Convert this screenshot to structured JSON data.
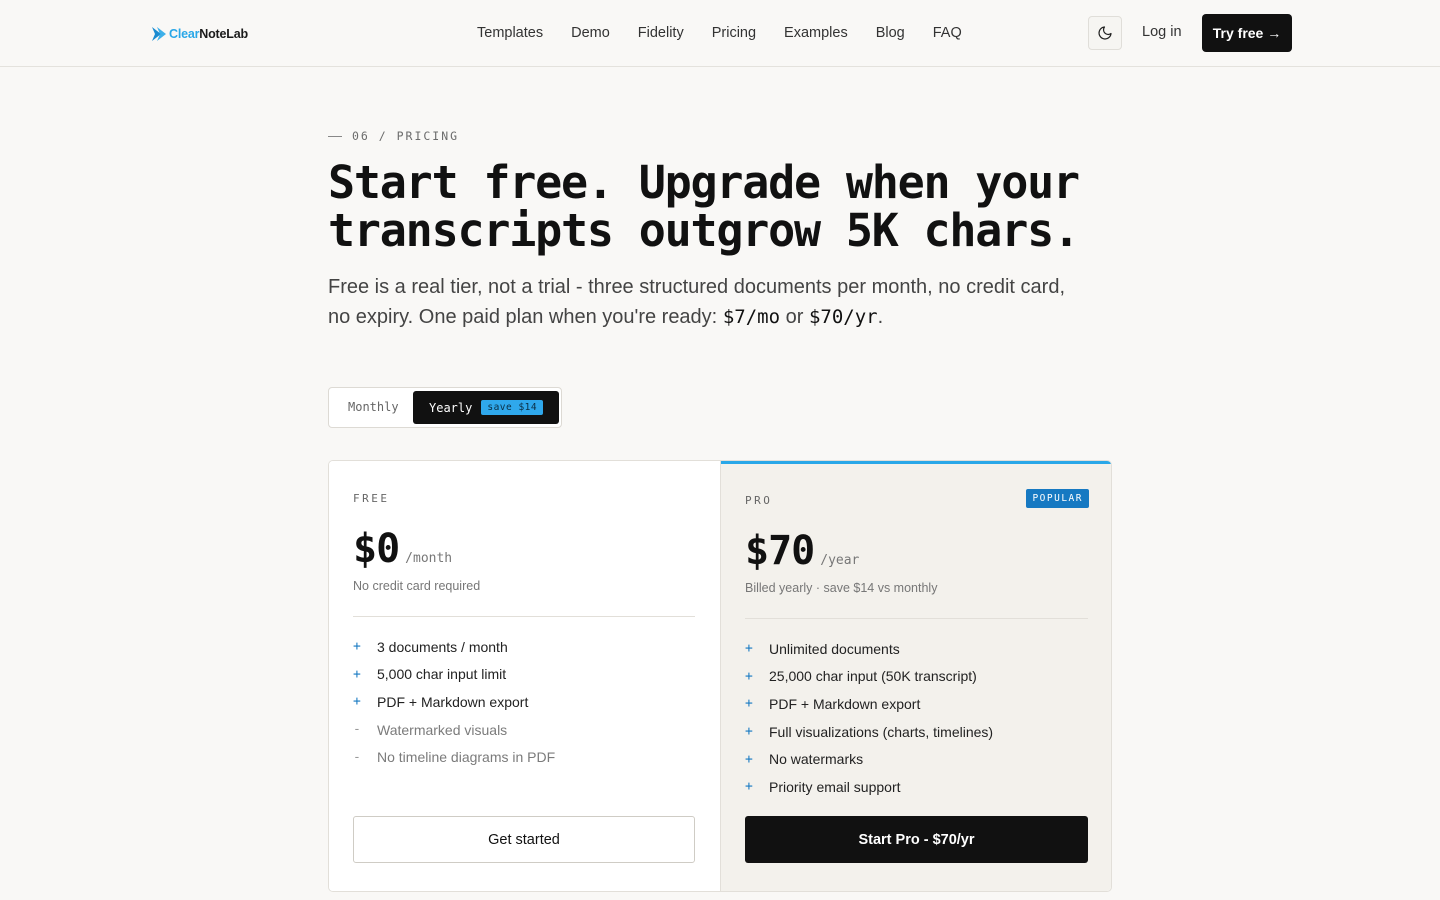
{
  "header": {
    "logo": {
      "brand_accent": "Clear",
      "brand_rest": "NoteLab",
      "icon": "logo-chevron-icon",
      "accent_color": "#29a7e8"
    },
    "nav": [
      "Templates",
      "Demo",
      "Fidelity",
      "Pricing",
      "Examples",
      "Blog",
      "FAQ"
    ],
    "theme_toggle_icon": "moon-icon",
    "login": "Log in",
    "cta": "Try free →"
  },
  "hero": {
    "eyebrow": "06 / PRICING",
    "headline_line1": "Start free. Upgrade when your",
    "headline_line2": "transcripts outgrow 5K chars.",
    "sub_text": "Free is a real tier, not a trial - three structured documents per month, no credit card, no expiry. One paid plan when you're ready:",
    "sub_price_monthly": "$7/mo",
    "sub_or": "or",
    "sub_price_yearly": "$70/yr",
    "sub_end": "."
  },
  "billing_toggle": {
    "monthly": "Monthly",
    "yearly": "Yearly",
    "save_badge": "save $14",
    "selected": "Yearly",
    "accent_color": "#2fa8ec"
  },
  "plans": {
    "free": {
      "name": "FREE",
      "price": "$0",
      "period": "/month",
      "note": "No credit card required",
      "features": [
        {
          "mark": "+",
          "text": "3 documents / month"
        },
        {
          "mark": "+",
          "text": "5,000 char input limit"
        },
        {
          "mark": "+",
          "text": "PDF + Markdown export"
        },
        {
          "mark": "-",
          "text": "Watermarked visuals"
        },
        {
          "mark": "-",
          "text": "No timeline diagrams in PDF"
        }
      ],
      "cta": "Get started"
    },
    "pro": {
      "name": "PRO",
      "badge": "POPULAR",
      "price": "$70",
      "period": "/year",
      "note": "Billed yearly · save $14 vs monthly",
      "features": [
        {
          "mark": "+",
          "text": "Unlimited documents"
        },
        {
          "mark": "+",
          "text": "25,000 char input (50K transcript)"
        },
        {
          "mark": "+",
          "text": "PDF + Markdown export"
        },
        {
          "mark": "+",
          "text": "Full visualizations (charts, timelines)"
        },
        {
          "mark": "+",
          "text": "No watermarks"
        },
        {
          "mark": "+",
          "text": "Priority email support"
        }
      ],
      "cta": "Start Pro - $70/yr",
      "accent_color": "#29a7e8",
      "badge_color": "#1679c2"
    }
  }
}
